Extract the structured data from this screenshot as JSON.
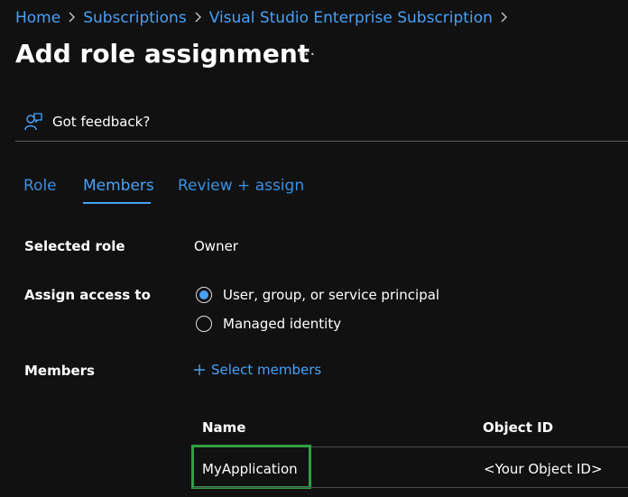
{
  "breadcrumb": {
    "items": [
      "Home",
      "Subscriptions",
      "Visual Studio Enterprise Subscription"
    ],
    "separator": ">"
  },
  "page": {
    "title": "Add role assignment",
    "more_label": "···"
  },
  "toolbar": {
    "feedback_label": "Got feedback?"
  },
  "tabs": [
    {
      "label": "Role",
      "active": false
    },
    {
      "label": "Members",
      "active": true
    },
    {
      "label": "Review + assign",
      "active": false
    }
  ],
  "form": {
    "selected_role_label": "Selected role",
    "selected_role_value": "Owner",
    "assign_access_label": "Assign access to",
    "assign_options": [
      {
        "label": "User, group, or service principal",
        "checked": true
      },
      {
        "label": "Managed identity",
        "checked": false
      }
    ],
    "members_label": "Members",
    "select_members_label": "Select members"
  },
  "members_table": {
    "columns": [
      "Name",
      "Object ID"
    ],
    "rows": [
      {
        "name": "MyApplication",
        "object_id": "<Your Object ID>"
      }
    ]
  },
  "colors": {
    "background": "#111111",
    "accent": "#4aa0f5",
    "highlight": "#2ea043"
  }
}
